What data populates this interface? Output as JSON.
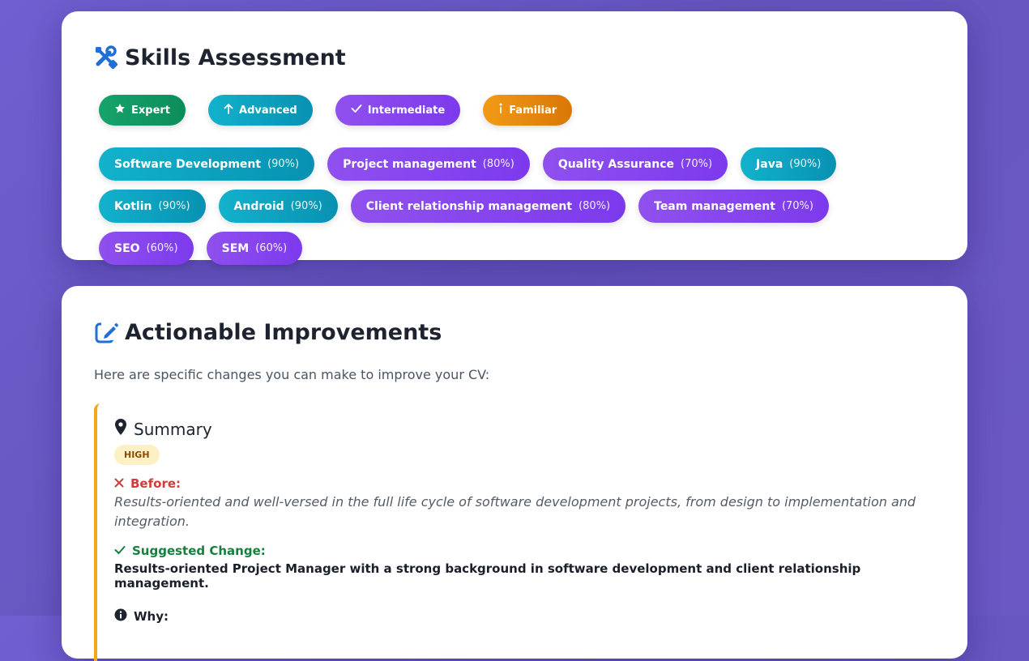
{
  "skills_section": {
    "title": "Skills Assessment",
    "legend": [
      {
        "label": "Expert",
        "icon": "star-icon"
      },
      {
        "label": "Advanced",
        "icon": "arrow-up-icon"
      },
      {
        "label": "Intermediate",
        "icon": "check-icon"
      },
      {
        "label": "Familiar",
        "icon": "info-icon"
      }
    ],
    "skills": [
      {
        "name": "Software Development",
        "percent": "(90%)",
        "level": "advanced"
      },
      {
        "name": "Project management",
        "percent": "(80%)",
        "level": "intermediate"
      },
      {
        "name": "Quality Assurance",
        "percent": "(70%)",
        "level": "intermediate"
      },
      {
        "name": "Java",
        "percent": "(90%)",
        "level": "advanced"
      },
      {
        "name": "Kotlin",
        "percent": "(90%)",
        "level": "advanced"
      },
      {
        "name": "Android",
        "percent": "(90%)",
        "level": "advanced"
      },
      {
        "name": "Client relationship management",
        "percent": "(80%)",
        "level": "intermediate"
      },
      {
        "name": "Team management",
        "percent": "(70%)",
        "level": "intermediate"
      },
      {
        "name": "SEO",
        "percent": "(60%)",
        "level": "intermediate"
      },
      {
        "name": "SEM",
        "percent": "(60%)",
        "level": "intermediate"
      }
    ]
  },
  "improvements_section": {
    "title": "Actionable Improvements",
    "intro": "Here are specific changes you can make to improve your CV:",
    "item": {
      "section": "Summary",
      "priority": "HIGH",
      "before_label": "Before:",
      "before_text": "Results-oriented and well-versed in the full life cycle of software development projects, from design to implementation and integration.",
      "change_label": "Suggested Change:",
      "change_text": "Results-oriented Project Manager with a strong background in software development and client relationship management.",
      "why_label": "Why:"
    }
  },
  "colors": {
    "expert": "#0c8d5b",
    "advanced": "#0891b2",
    "intermediate": "#7c3aed",
    "familiar": "#d97706",
    "priority_high_border": "#f0a818",
    "before": "#d33b3b",
    "suggested": "#15803d"
  }
}
